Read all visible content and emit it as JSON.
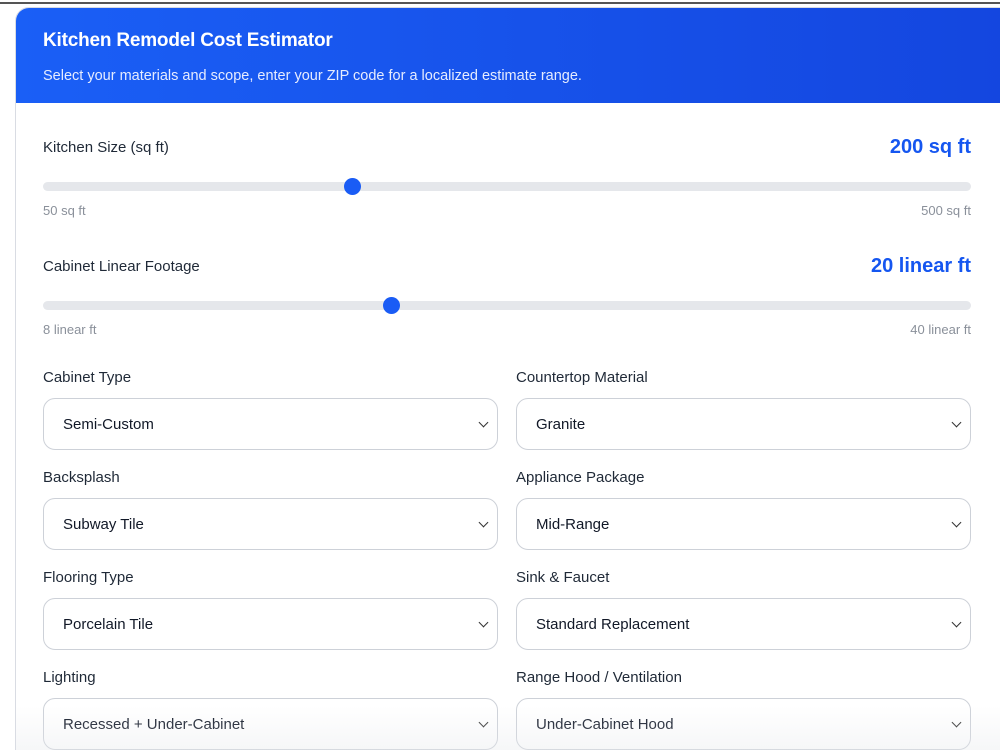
{
  "header": {
    "title": "Kitchen Remodel Cost Estimator",
    "subtitle": "Select your materials and scope, enter your ZIP code for a localized estimate range."
  },
  "sliders": [
    {
      "label": "Kitchen Size (sq ft)",
      "value_text": "200 sq ft",
      "value": 200,
      "min": 50,
      "max": 500,
      "min_label": "50 sq ft",
      "max_label": "500 sq ft"
    },
    {
      "label": "Cabinet Linear Footage",
      "value_text": "20 linear ft",
      "value": 20,
      "min": 8,
      "max": 40,
      "min_label": "8 linear ft",
      "max_label": "40 linear ft"
    }
  ],
  "fields": [
    {
      "label": "Cabinet Type",
      "value": "Semi-Custom"
    },
    {
      "label": "Countertop Material",
      "value": "Granite"
    },
    {
      "label": "Backsplash",
      "value": "Subway Tile"
    },
    {
      "label": "Appliance Package",
      "value": "Mid-Range"
    },
    {
      "label": "Flooring Type",
      "value": "Porcelain Tile"
    },
    {
      "label": "Sink & Faucet",
      "value": "Standard Replacement"
    },
    {
      "label": "Lighting",
      "value": "Recessed + Under-Cabinet"
    },
    {
      "label": "Range Hood / Ventilation",
      "value": "Under-Cabinet Hood"
    }
  ]
}
